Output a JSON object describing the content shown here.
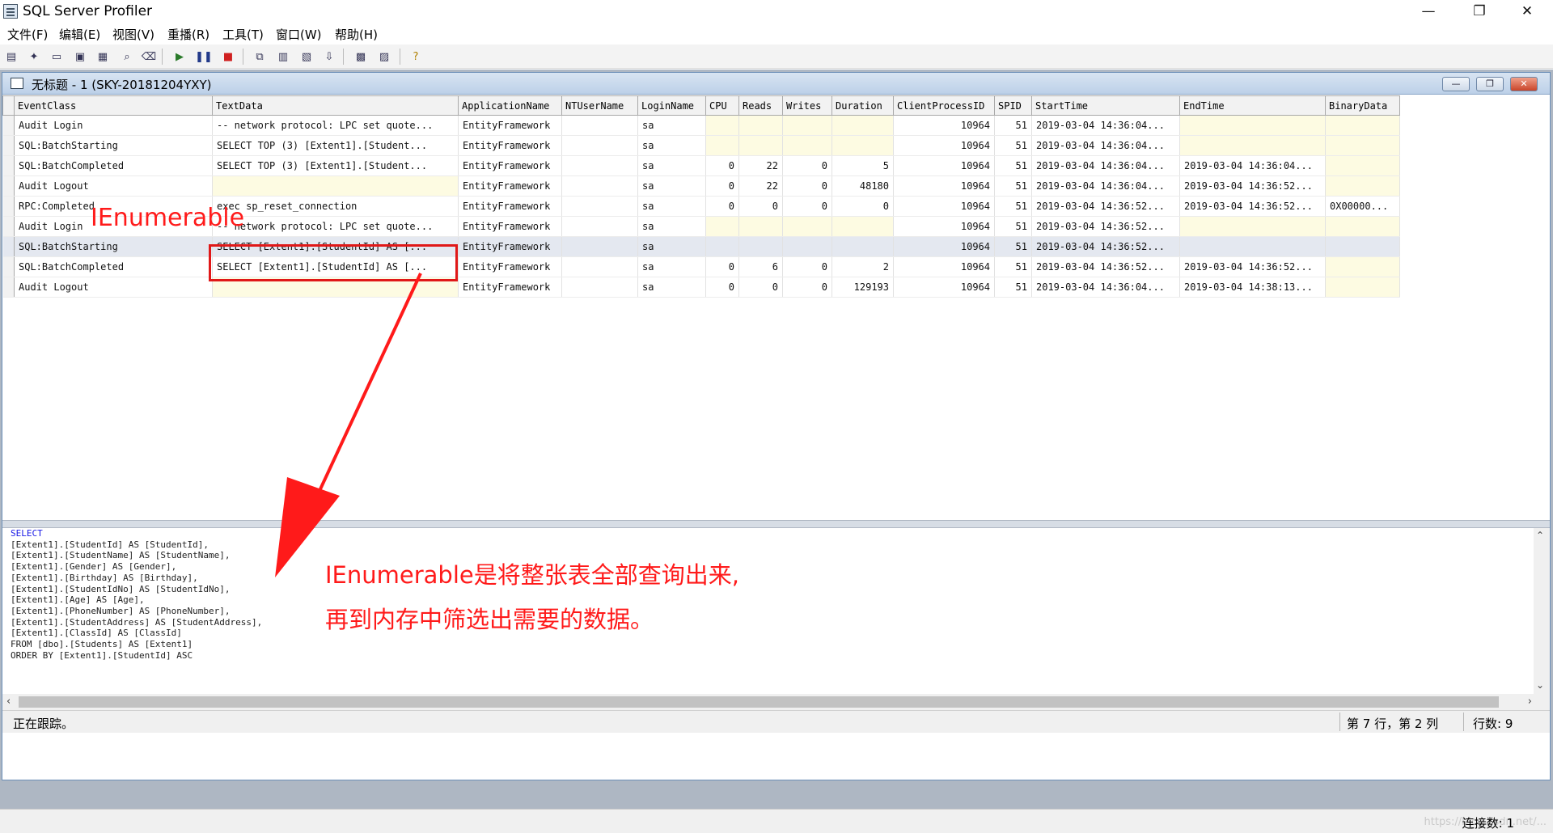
{
  "window": {
    "title": "SQL Server Profiler",
    "minimize": "—",
    "restore": "❐",
    "close": "✕"
  },
  "menu": [
    "文件(F)",
    "编辑(E)",
    "视图(V)",
    "重播(R)",
    "工具(T)",
    "窗口(W)",
    "帮助(H)"
  ],
  "toolbar": {
    "icons": [
      "properties-icon",
      "new-trace-icon",
      "open-icon",
      "save-icon",
      "template-icon",
      "find-icon",
      "clear-icon",
      "run-icon",
      "pause-icon",
      "stop-icon",
      "autoscroll-icon",
      "columns-icon",
      "filter-icon",
      "import-icon",
      "perfmon-icon",
      "sql-icon",
      "help-icon"
    ]
  },
  "trace_window": {
    "title": "无标题 - 1 (SKY-20181204YXY)",
    "buttons": {
      "minimize": "—",
      "restore": "❐",
      "close": "✕"
    }
  },
  "grid": {
    "columns": [
      "EventClass",
      "TextData",
      "ApplicationName",
      "NTUserName",
      "LoginName",
      "CPU",
      "Reads",
      "Writes",
      "Duration",
      "ClientProcessID",
      "SPID",
      "StartTime",
      "EndTime",
      "BinaryData"
    ],
    "rows": [
      [
        "Audit Login",
        "-- network protocol: LPC  set quote...",
        "EntityFramework",
        "",
        "sa",
        "",
        "",
        "",
        "",
        "10964",
        "51",
        "2019-03-04 14:36:04...",
        "",
        ""
      ],
      [
        "SQL:BatchStarting",
        "SELECT TOP (3)   [Extent1].[Student...",
        "EntityFramework",
        "",
        "sa",
        "",
        "",
        "",
        "",
        "10964",
        "51",
        "2019-03-04 14:36:04...",
        "",
        ""
      ],
      [
        "SQL:BatchCompleted",
        "SELECT TOP (3)   [Extent1].[Student...",
        "EntityFramework",
        "",
        "sa",
        "0",
        "22",
        "0",
        "5",
        "10964",
        "51",
        "2019-03-04 14:36:04...",
        "2019-03-04 14:36:04...",
        ""
      ],
      [
        "Audit Logout",
        "",
        "EntityFramework",
        "",
        "sa",
        "0",
        "22",
        "0",
        "48180",
        "10964",
        "51",
        "2019-03-04 14:36:04...",
        "2019-03-04 14:36:52...",
        ""
      ],
      [
        "RPC:Completed",
        "exec sp_reset_connection",
        "EntityFramework",
        "",
        "sa",
        "0",
        "0",
        "0",
        "0",
        "10964",
        "51",
        "2019-03-04 14:36:52...",
        "2019-03-04 14:36:52...",
        "0X00000..."
      ],
      [
        "Audit Login",
        "-- network protocol: LPC  set quote...",
        "EntityFramework",
        "",
        "sa",
        "",
        "",
        "",
        "",
        "10964",
        "51",
        "2019-03-04 14:36:52...",
        "",
        ""
      ],
      [
        "SQL:BatchStarting",
        "SELECT   [Extent1].[StudentId] AS [...",
        "EntityFramework",
        "",
        "sa",
        "",
        "",
        "",
        "",
        "10964",
        "51",
        "2019-03-04 14:36:52...",
        "",
        ""
      ],
      [
        "SQL:BatchCompleted",
        "SELECT   [Extent1].[StudentId] AS [...",
        "EntityFramework",
        "",
        "sa",
        "0",
        "6",
        "0",
        "2",
        "10964",
        "51",
        "2019-03-04 14:36:52...",
        "2019-03-04 14:36:52...",
        ""
      ],
      [
        "Audit Logout",
        "",
        "EntityFramework",
        "",
        "sa",
        "0",
        "0",
        "0",
        "129193",
        "10964",
        "51",
        "2019-03-04 14:36:04...",
        "2019-03-04 14:38:13...",
        ""
      ]
    ],
    "selected_row_index": 6
  },
  "sql_text": [
    {
      "kw": "SELECT",
      "rest": ""
    },
    {
      "kw": "",
      "rest": "[Extent1].[StudentId] AS [StudentId],"
    },
    {
      "kw": "",
      "rest": "[Extent1].[StudentName] AS [StudentName],"
    },
    {
      "kw": "",
      "rest": "[Extent1].[Gender] AS [Gender],"
    },
    {
      "kw": "",
      "rest": "[Extent1].[Birthday] AS [Birthday],"
    },
    {
      "kw": "",
      "rest": "[Extent1].[StudentIdNo] AS [StudentIdNo],"
    },
    {
      "kw": "",
      "rest": "[Extent1].[Age] AS [Age],"
    },
    {
      "kw": "",
      "rest": "[Extent1].[PhoneNumber] AS [PhoneNumber],"
    },
    {
      "kw": "",
      "rest": "[Extent1].[StudentAddress] AS [StudentAddress],"
    },
    {
      "kw": "",
      "rest": "[Extent1].[ClassId] AS [ClassId]"
    },
    {
      "kw": "",
      "rest": "FROM [dbo].[Students] AS [Extent1]"
    },
    {
      "kw": "",
      "rest": "ORDER BY [Extent1].[StudentId] ASC"
    }
  ],
  "status": {
    "left": "正在跟踪。",
    "position": "第 7 行，第 2 列",
    "rows": "行数: 9"
  },
  "app_status": {
    "connections": "连接数: 1",
    "watermark": "https://blog.csdn.net/..."
  },
  "annotations": {
    "label": "IEnumerable",
    "note_line1": "IEnumerable是将整张表全部查询出来,",
    "note_line2": "再到内存中筛选出需要的数据。",
    "color": "#ff1a1a"
  },
  "colors": {
    "empty_cell": "#fdfbe2",
    "selected_row": "#e4e8f0",
    "keyword": "#1a1ae6"
  }
}
